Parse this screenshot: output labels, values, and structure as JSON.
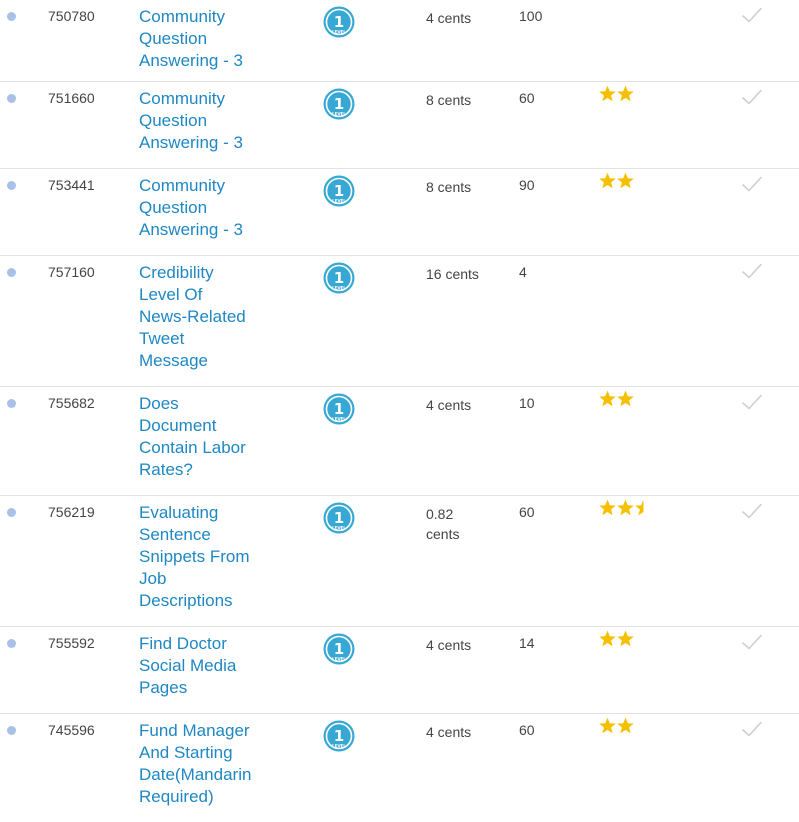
{
  "colors": {
    "link": "#1e87c4",
    "star": "#f5c000",
    "badge": "#37a8d4",
    "check": "#cfcfcf",
    "dot": "#a9c1e6"
  },
  "level_badge_icon": "level-1-badge-icon",
  "tasks": [
    {
      "id": "750780",
      "title": "Community Question Answering - 3",
      "reward": "4 cents",
      "hits": "100",
      "stars": 0
    },
    {
      "id": "751660",
      "title": "Community Question Answering - 3",
      "reward": "8 cents",
      "hits": "60",
      "stars": 2
    },
    {
      "id": "753441",
      "title": "Community Question Answering - 3",
      "reward": "8 cents",
      "hits": "90",
      "stars": 2
    },
    {
      "id": "757160",
      "title": "Credibility Level Of News-Related Tweet Message",
      "reward": "16 cents",
      "hits": "4",
      "stars": 0
    },
    {
      "id": "755682",
      "title": "Does Document Contain Labor Rates?",
      "reward": "4 cents",
      "hits": "10",
      "stars": 2
    },
    {
      "id": "756219",
      "title": "Evaluating Sentence Snippets From Job Descriptions",
      "reward": "0.82 cents",
      "hits": "60",
      "stars": 2.5
    },
    {
      "id": "755592",
      "title": "Find Doctor Social Media Pages",
      "reward": "4 cents",
      "hits": "14",
      "stars": 2
    },
    {
      "id": "745596",
      "title": "Fund Manager And Starting Date(Mandarin Required)",
      "reward": "4 cents",
      "hits": "60",
      "stars": 2
    }
  ]
}
